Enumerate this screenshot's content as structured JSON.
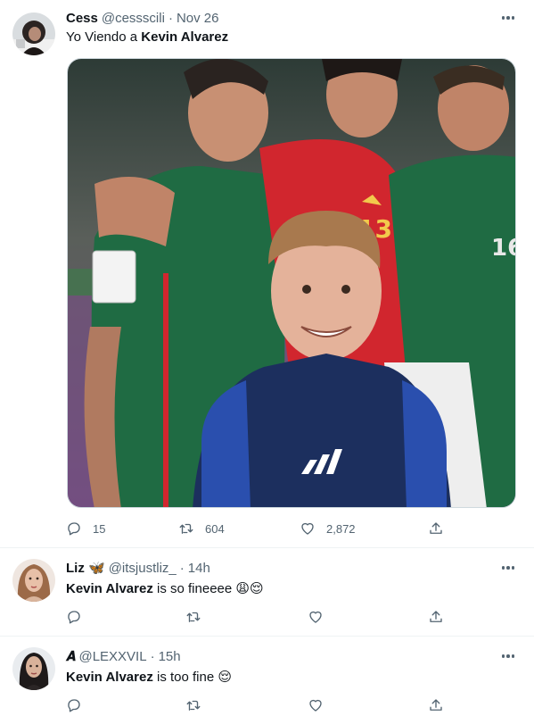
{
  "tweets": [
    {
      "author_name": "Cess",
      "handle": "@cessscili",
      "separator": "·",
      "time": "Nov 26",
      "text_prefix": "Yo Viendo a ",
      "text_bold": "Kevin Alvarez",
      "text_suffix": "",
      "has_media": true,
      "replies": "15",
      "retweets": "604",
      "likes": "2,872"
    },
    {
      "author_name": "Liz 🦋",
      "handle": "@itsjustliz_",
      "separator": "·",
      "time": "14h",
      "text_prefix": "",
      "text_bold": "Kevin Alvarez",
      "text_suffix": " is so fineeee 😩😌",
      "has_media": false,
      "replies": "",
      "retweets": "",
      "likes": ""
    },
    {
      "author_name": "𝑨",
      "handle": "@LEXXVIL",
      "separator": "·",
      "time": "15h",
      "text_prefix": "",
      "text_bold": "Kevin Alvarez",
      "text_suffix": " is too fine 😌",
      "has_media": false,
      "replies": "",
      "retweets": "",
      "likes": ""
    }
  ],
  "icons": {
    "reply": "reply-icon",
    "retweet": "retweet-icon",
    "like": "heart-icon",
    "share": "share-icon",
    "more": "more-options-icon"
  },
  "colors": {
    "secondary_text": "#536471",
    "primary_text": "#0f1419",
    "divider": "#eff3f4",
    "jersey_green": "#1f6b43",
    "jersey_red": "#d1262e",
    "jacket_navy": "#1c2f5e"
  }
}
